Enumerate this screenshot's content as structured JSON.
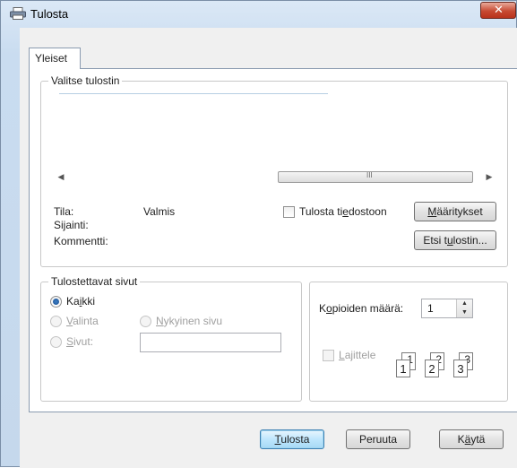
{
  "window": {
    "title": "Tulosta",
    "close_label": "✕",
    "icon": "printer-icon"
  },
  "tabs": [
    {
      "label": "Yleiset",
      "selected": true
    }
  ],
  "printer_group": {
    "label": "Valitse tulostin",
    "scroll_left_icon": "scroll-left-icon",
    "scroll_right_icon": "scroll-right-icon",
    "scroll_thumb_grip": "III",
    "status_label": "Tila:",
    "status_value": "Valmis",
    "location_label": "Sijainti:",
    "comment_label": "Kommentti:",
    "print_to_file": {
      "label_pre": "Tulosta ti",
      "label_u": "e",
      "label_post": "dostoon",
      "checked": false
    },
    "preferences_button": {
      "label_pre": "",
      "label_u": "M",
      "label_post": "ääritykset"
    },
    "find_printer_button": {
      "label_pre": "Etsi t",
      "label_u": "u",
      "label_post": "lostin..."
    }
  },
  "page_range": {
    "label": "Tulostettavat sivut",
    "all": {
      "label_pre": "Ka",
      "label_u": "i",
      "label_post": "kki",
      "checked": true
    },
    "selection": {
      "label_pre": "",
      "label_u": "V",
      "label_post": "alinta",
      "enabled": false
    },
    "current_page": {
      "label_pre": "",
      "label_u": "N",
      "label_post": "ykyinen sivu",
      "enabled": false
    },
    "pages": {
      "label_pre": "",
      "label_u": "S",
      "label_post": "ivut:",
      "enabled": false,
      "value": ""
    }
  },
  "copies": {
    "label_pre": "K",
    "label_u": "o",
    "label_post": "pioiden määrä:",
    "value": "1",
    "collate": {
      "label_pre": "",
      "label_u": "L",
      "label_post": "ajittele",
      "checked": false,
      "enabled": false
    },
    "collate_pages": [
      "1",
      "1",
      "2",
      "2",
      "3",
      "3"
    ]
  },
  "footer": {
    "print_button": {
      "label_pre": "",
      "label_u": "T",
      "label_post": "ulosta"
    },
    "cancel_button": {
      "label": "Peruuta"
    },
    "apply_button": {
      "label_pre": "K",
      "label_u": "ä",
      "label_post": "ytä"
    }
  },
  "colors": {
    "window_frame": "#c9dcf0",
    "close_button": "#c74a32",
    "default_button": "#bee6fd",
    "radio_fill": "#1b4f91"
  }
}
